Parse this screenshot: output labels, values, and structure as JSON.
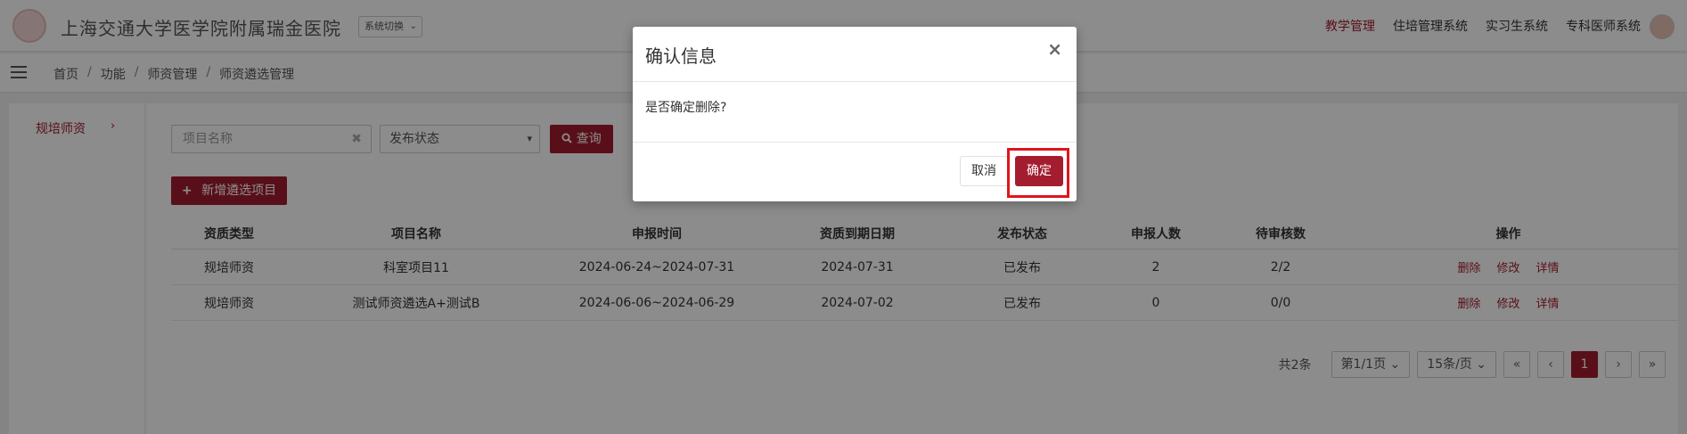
{
  "header": {
    "site_title": "上海交通大学医学院附属瑞金医院",
    "system_switch": "系统切换",
    "nav": [
      "教学管理",
      "住培管理系统",
      "实习生系统",
      "专科医师系统"
    ],
    "active_nav": "教学管理"
  },
  "breadcrumb": [
    "首页",
    "功能",
    "师资管理",
    "师资遴选管理"
  ],
  "breadcrumb_sep": "/",
  "sidebar": {
    "items": [
      {
        "label": "规培师资",
        "arrow": "›"
      }
    ]
  },
  "filters": {
    "project_name_placeholder": "项目名称",
    "clear_glyph": "✖",
    "status_select": "发布状态",
    "query_button": "查询",
    "add_button": "新增遴选项目"
  },
  "table": {
    "columns": [
      "资质类型",
      "项目名称",
      "申报时间",
      "资质到期日期",
      "发布状态",
      "申报人数",
      "待审核数",
      "操作"
    ],
    "rows": [
      {
        "type": "规培师资",
        "name": "科室项目11",
        "period": "2024-06-24~2024-07-31",
        "expiry": "2024-07-31",
        "status": "已发布",
        "applicants": "2",
        "pending": "2/2"
      },
      {
        "type": "规培师资",
        "name": "测试师资遴选A+测试B",
        "period": "2024-06-06~2024-06-29",
        "expiry": "2024-07-02",
        "status": "已发布",
        "applicants": "0",
        "pending": "0/0"
      }
    ],
    "actions": [
      "删除",
      "修改",
      "详情"
    ]
  },
  "pagination": {
    "total": "共2条",
    "page_info": "第1/1页",
    "page_size": "15条/页",
    "first": "«",
    "prev": "‹",
    "current": "1",
    "next": "›",
    "last": "»"
  },
  "modal": {
    "title": "确认信息",
    "close": "×",
    "message": "是否确定删除?",
    "cancel": "取消",
    "confirm": "确定"
  },
  "colors": {
    "accent": "#a31d2f",
    "highlight": "#e0151c"
  }
}
